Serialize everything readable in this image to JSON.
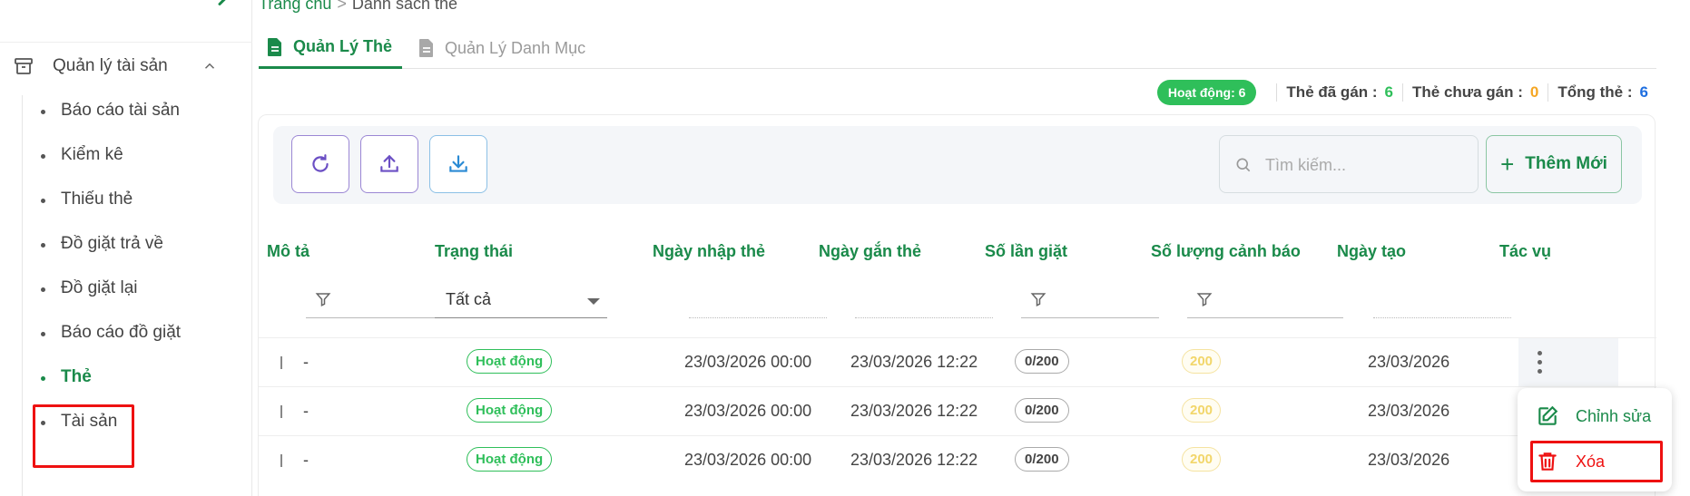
{
  "sidebar": {
    "group_label": "Quản lý tài sản",
    "items": [
      {
        "label": "Báo cáo tài sản"
      },
      {
        "label": "Kiểm kê"
      },
      {
        "label": "Thiếu thẻ"
      },
      {
        "label": "Đồ giặt trả về"
      },
      {
        "label": "Đồ giặt lại"
      },
      {
        "label": "Báo cáo đồ giặt"
      },
      {
        "label": "Thẻ"
      },
      {
        "label": "Tài sản"
      }
    ],
    "active_index": 6
  },
  "breadcrumb": {
    "home": "Trang chủ",
    "separator": ">",
    "current": "Danh sách thẻ"
  },
  "tabs": [
    {
      "label": "Quản Lý Thẻ",
      "active": true
    },
    {
      "label": "Quản Lý Danh Mục",
      "active": false
    }
  ],
  "stats": {
    "active_pill": "Hoạt động: 6",
    "assigned_label": "Thẻ đã gán :",
    "assigned_value": "6",
    "unassigned_label": "Thẻ chưa gán :",
    "unassigned_value": "0",
    "total_label": "Tổng thẻ :",
    "total_value": "6"
  },
  "toolbar": {
    "search_placeholder": "Tìm kiếm...",
    "add_label": "Thêm Mới"
  },
  "table": {
    "columns": [
      "Mô tả",
      "Trạng thái",
      "Ngày nhập thẻ",
      "Ngày gắn thẻ",
      "Số lần giặt",
      "Số lượng cảnh báo",
      "Ngày tạo",
      "Tác vụ"
    ],
    "status_filter_value": "Tất cả",
    "rows": [
      {
        "description": "-",
        "status": "Hoạt động",
        "import_date": "23/03/2026 00:00",
        "attach_date": "23/03/2026 12:22",
        "wash_count": "0/200",
        "warning_count": "200",
        "created": "23/03/2026"
      },
      {
        "description": "-",
        "status": "Hoạt động",
        "import_date": "23/03/2026 00:00",
        "attach_date": "23/03/2026 12:22",
        "wash_count": "0/200",
        "warning_count": "200",
        "created": "23/03/2026"
      },
      {
        "description": "-",
        "status": "Hoạt động",
        "import_date": "23/03/2026 00:00",
        "attach_date": "23/03/2026 12:22",
        "wash_count": "0/200",
        "warning_count": "200",
        "created": "23/03/2026"
      }
    ]
  },
  "action_menu": {
    "edit_label": "Chỉnh sửa",
    "delete_label": "Xóa"
  },
  "colors": {
    "primary": "#1a8a4a",
    "active_pill": "#2fbf5a",
    "warning": "#f5a623",
    "total": "#1f6fe0",
    "danger": "#e11111"
  }
}
